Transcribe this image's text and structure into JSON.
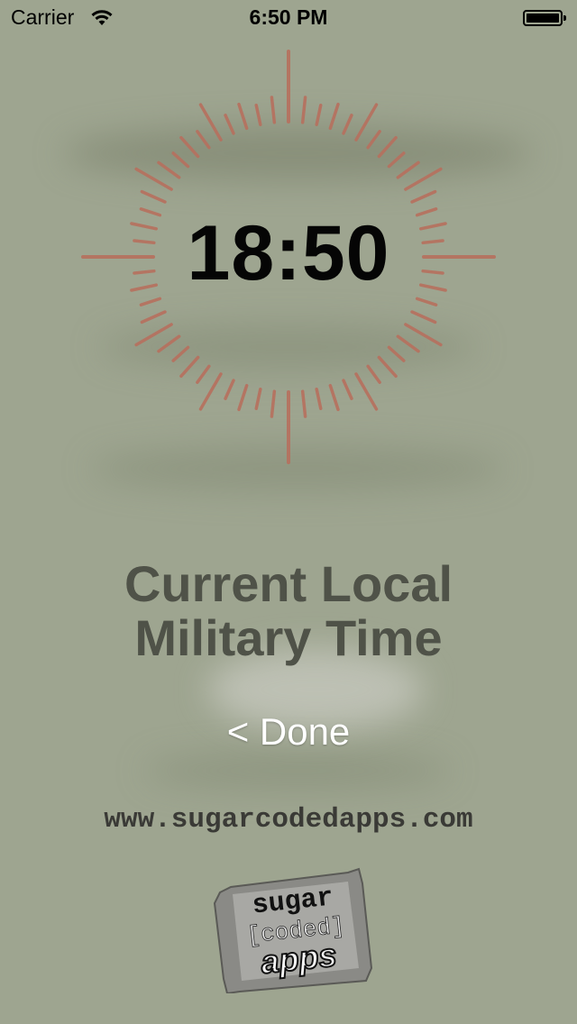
{
  "status_bar": {
    "carrier": "Carrier",
    "time": "6:50 PM",
    "icons": [
      "wifi-icon",
      "battery-icon"
    ]
  },
  "clock": {
    "time": "18:50",
    "tick_color": "#b7705e"
  },
  "caption": {
    "line1": "Current Local",
    "line2": "Military Time"
  },
  "done_button": {
    "label": "< Done"
  },
  "website": {
    "url": "www.sugarcodedapps.com"
  },
  "logo": {
    "line1": "sugar",
    "line2": "[coded]",
    "line3": "apps"
  },
  "colors": {
    "background": "#9ea590",
    "caption_text": "#4f5248",
    "done_text": "#ffffff"
  }
}
